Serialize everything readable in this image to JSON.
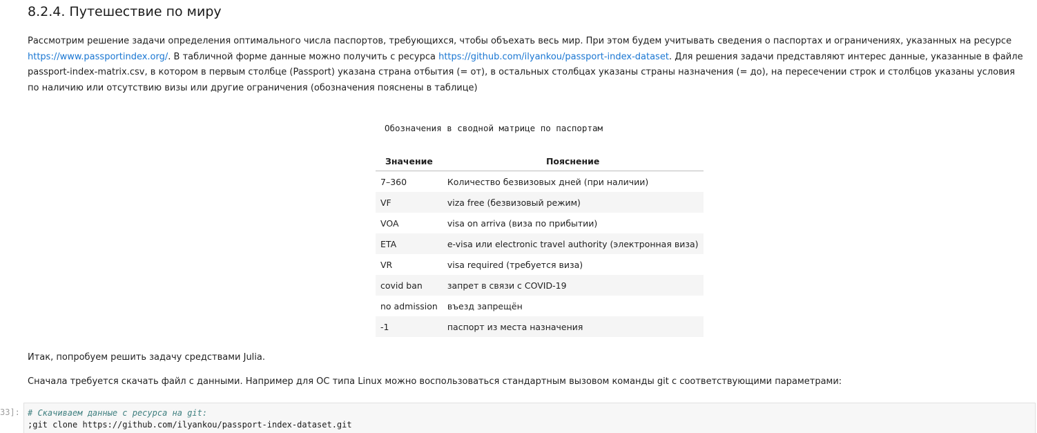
{
  "heading": "8.2.4. Путешествие по миру",
  "intro": {
    "text1": "Рассмотрим решение задачи определения оптимального числа паспортов, требующихся, чтобы объехать весь мир. При этом будем учитывать сведения о паспортах и ограничениях, указанных на ресурсе",
    "link1": "https://www.passportindex.org/",
    "text2": ". В табличной форме данные можно получить с ресурса",
    "link2": "https://github.com/ilyankou/passport-index-dataset",
    "text3": ". Для решения задачи представляют интерес данные, указанные в файле passport-index-matrix.csv, в котором в первым столбце (Passport) указана страна отбытия (= от), в остальных столбцах указаны страны назначения (= до), на пересечении строк и столбцов указаны условия по наличию или отсутствию визы или другие ограничения (обозначения пояснены в таблице)"
  },
  "table": {
    "caption": "Обозначения в сводной матрице по паспортам",
    "headers": [
      "Значение",
      "Пояснение"
    ],
    "rows": [
      [
        "7–360",
        "Количество безвизовых дней (при наличии)"
      ],
      [
        "VF",
        "viza free (безвизовый режим)"
      ],
      [
        "VOA",
        "visa on arriva (виза по прибытии)"
      ],
      [
        "ETA",
        "e-visa или electronic travel authority (электронная виза)"
      ],
      [
        "VR",
        "visa required (требуется виза)"
      ],
      [
        "covid ban",
        "запрет в связи с COVID-19"
      ],
      [
        "no admission",
        "въезд запрещён"
      ],
      [
        "-1",
        "паспорт из места назначения"
      ]
    ]
  },
  "para2": "Итак, попробуем решить задачу средствами Julia.",
  "para3": "Сначала требуется скачать файл с данными. Например для ОС типа Linux можно воспользоваться стандартным вызовом команды git с соответствующими параметрами:",
  "cell": {
    "prompt": "33]:",
    "comment": "# Скачиваем данные с ресурса на git:",
    "command": ";git clone https://github.com/ilyankou/passport-index-dataset.git"
  }
}
